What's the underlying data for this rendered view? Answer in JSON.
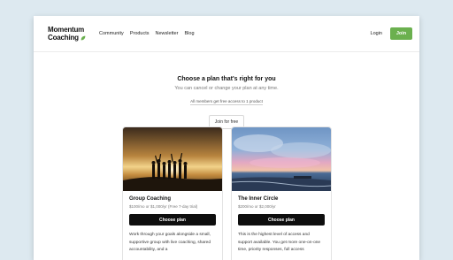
{
  "brand": {
    "line1": "Momentum",
    "line2": "Coaching",
    "accent": "#6bb04f"
  },
  "nav": {
    "links": [
      "Community",
      "Products",
      "Newsletter",
      "Blog"
    ],
    "login": "Login",
    "join": "Join"
  },
  "hero": {
    "title": "Choose a plan that's right for you",
    "subtitle": "You can cancel or change your plan at any time.",
    "note": "All members get free access to 1 product",
    "free_button": "Join for free"
  },
  "plans": [
    {
      "title": "Group Coaching",
      "price": "$100/mo or $1,000/yr (Free 7-day trial)",
      "button": "Choose plan",
      "description": "Work through your goals alongside a small, supportive group with live coaching, shared accountability, and a"
    },
    {
      "title": "The Inner Circle",
      "price": "$200/mo or $2,000/yr",
      "button": "Choose plan",
      "description": "This is the highest level of access and support available. You get more one-on-one time, priority responses, full access"
    }
  ]
}
